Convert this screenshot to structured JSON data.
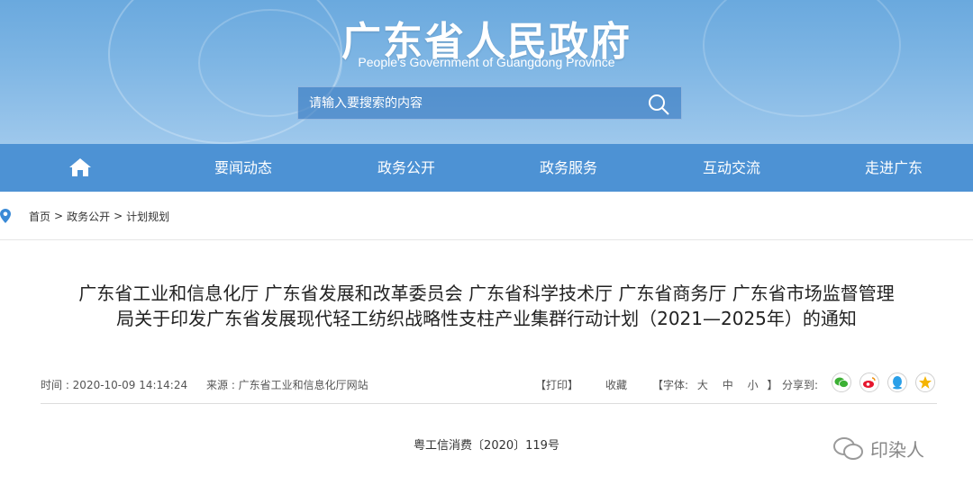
{
  "header": {
    "title": "广东省人民政府",
    "subtitle": "People's Government of Guangdong Province",
    "search_placeholder": "请输入要搜索的内容"
  },
  "nav": {
    "home_icon": "home-icon",
    "items": [
      "要闻动态",
      "政务公开",
      "政务服务",
      "互动交流",
      "走进广东"
    ]
  },
  "breadcrumb": {
    "icon": "location-pin-icon",
    "items": [
      "首页",
      ">",
      "政务公开",
      ">",
      "计划规划"
    ]
  },
  "article": {
    "title_line1": "广东省工业和信息化厅 广东省发展和改革委员会 广东省科学技术厅 广东省商务厅 广东省市场监督管理",
    "title_line2": "局关于印发广东省发展现代轻工纺织战略性支柱产业集群行动计划（2021—2025年）的通知",
    "time_label": "时间 : 2020-10-09 14:14:24",
    "source_label": "来源 : 广东省工业和信息化厅网站",
    "print": "【打印】",
    "favorite": "收藏",
    "font_prefix": "【字体:",
    "font_large": "大",
    "font_medium": "中",
    "font_small": "小",
    "font_suffix": "】",
    "share_label": "分享到:",
    "share_icons": [
      "wechat-icon",
      "weibo-icon",
      "qq-icon",
      "qzone-icon"
    ],
    "doc_number": "粤工信消费〔2020〕119号"
  },
  "watermark": {
    "text": "印染人",
    "icon": "wechat-watermark-icon"
  },
  "colors": {
    "nav_bg": "#4d92d4",
    "banner_top": "#6aa9de",
    "wechat": "#3cb034",
    "weibo": "#e6162d",
    "qq": "#2a9fe8",
    "qzone": "#f5b400"
  }
}
